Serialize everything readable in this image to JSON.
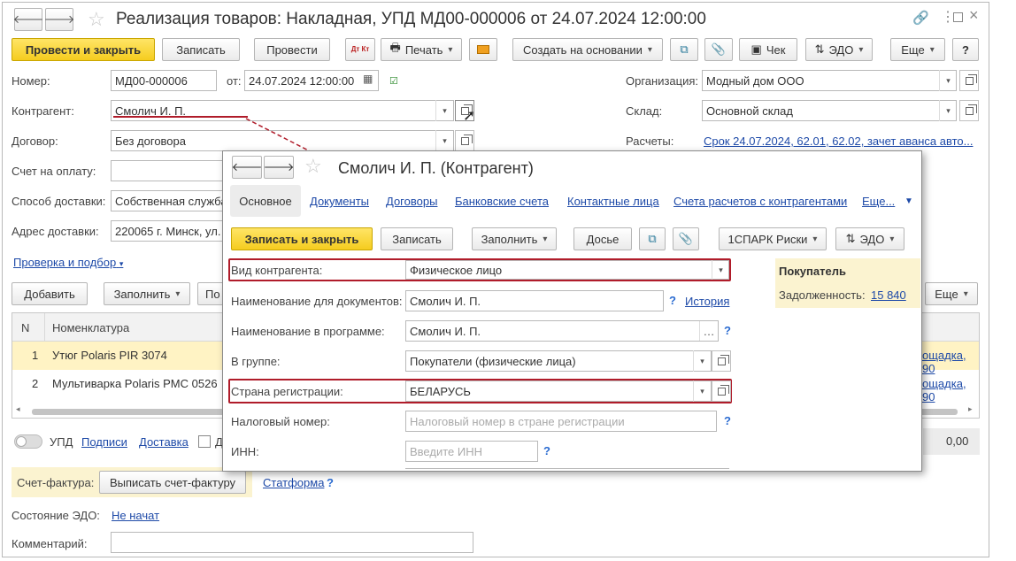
{
  "main": {
    "title": "Реализация товаров: Накладная, УПД МД00-000006 от 24.07.2024 12:00:00",
    "toolbar": {
      "post_close": "Провести и закрыть",
      "save": "Записать",
      "post": "Провести",
      "dt_kt": "Дт Кт",
      "print": "Печать",
      "create_based": "Создать на основании",
      "receipt": "Чек",
      "edo": "ЭДО",
      "more": "Еще",
      "help": "?"
    },
    "fields": {
      "number_label": "Номер:",
      "number_value": "МД00-000006",
      "from_label": "от:",
      "date_value": "24.07.2024 12:00:00",
      "org_label": "Организация:",
      "org_value": "Модный дом ООО",
      "contractor_label": "Контрагент:",
      "contractor_value": "Смолич И. П.",
      "warehouse_label": "Склад:",
      "warehouse_value": "Основной склад",
      "contract_label": "Договор:",
      "contract_value": "Без договора",
      "settlements_label": "Расчеты:",
      "settlements_value": "Срок 24.07.2024, 62.01, 62.02, зачет аванса авто...",
      "invoice_pay_label": "Счет на оплату:",
      "delivery_method_label": "Способ доставки:",
      "delivery_method_value": "Собственная служба",
      "delivery_address_label": "Адрес доставки:",
      "delivery_address_value": "220065 г. Минск, ул.",
      "check_link": "Проверка и подбор"
    },
    "table_toolbar": {
      "add": "Добавить",
      "fill": "Заполнить",
      "partial": "По",
      "more": "Еще"
    },
    "table": {
      "col_n": "N",
      "col_item": "Номенклатура",
      "rows": [
        {
          "n": "1",
          "item": "Утюг Polaris PIR 3074",
          "tail": "ощадка, 90"
        },
        {
          "n": "2",
          "item": "Мультиварка Polaris PMC 0526",
          "tail": "ощадка, 90"
        }
      ]
    },
    "footer": {
      "upd": "УПД",
      "signatures": "Подписи",
      "delivery": "Доставка",
      "d_partial": "Д",
      "total": "0,00",
      "invoice_label": "Счет-фактура:",
      "issue_invoice": "Выписать счет-фактуру",
      "statforma": "Статформа",
      "edo_state_label": "Состояние ЭДО:",
      "edo_state_value": "Не начат",
      "comment_label": "Комментарий:"
    }
  },
  "sub": {
    "title": "Смолич И. П. (Контрагент)",
    "tabs": [
      "Основное",
      "Документы",
      "Договоры",
      "Банковские счета",
      "Контактные лица",
      "Счета расчетов с контрагентами",
      "Еще..."
    ],
    "toolbar": {
      "save_close": "Записать и закрыть",
      "save": "Записать",
      "fill": "Заполнить",
      "dossier": "Досье",
      "spark": "1СПАРК Риски",
      "edo": "ЭДО"
    },
    "fields": {
      "type_label": "Вид контрагента:",
      "type_value": "Физическое лицо",
      "docname_label": "Наименование для документов:",
      "docname_value": "Смолич И. П.",
      "history": "История",
      "progname_label": "Наименование в программе:",
      "progname_value": "Смолич И. П.",
      "group_label": "В группе:",
      "group_value": "Покупатели (физические лица)",
      "country_label": "Страна регистрации:",
      "country_value": "БЕЛАРУСЬ",
      "tax_label": "Налоговый номер:",
      "tax_placeholder": "Налоговый номер в стране регистрации",
      "inn_label": "ИНН:",
      "inn_placeholder": "Введите ИНН"
    },
    "buyer_panel": {
      "title": "Покупатель",
      "debt_label": "Задолженность:",
      "debt_value": "15 840"
    }
  },
  "colors": {
    "accent_yellow": "#f5cc1e",
    "link_blue": "#1e4aa8",
    "highlight_red": "#b01c2a",
    "selected_row": "#fff3c4",
    "buyer_panel_bg": "#fbf3d0"
  }
}
